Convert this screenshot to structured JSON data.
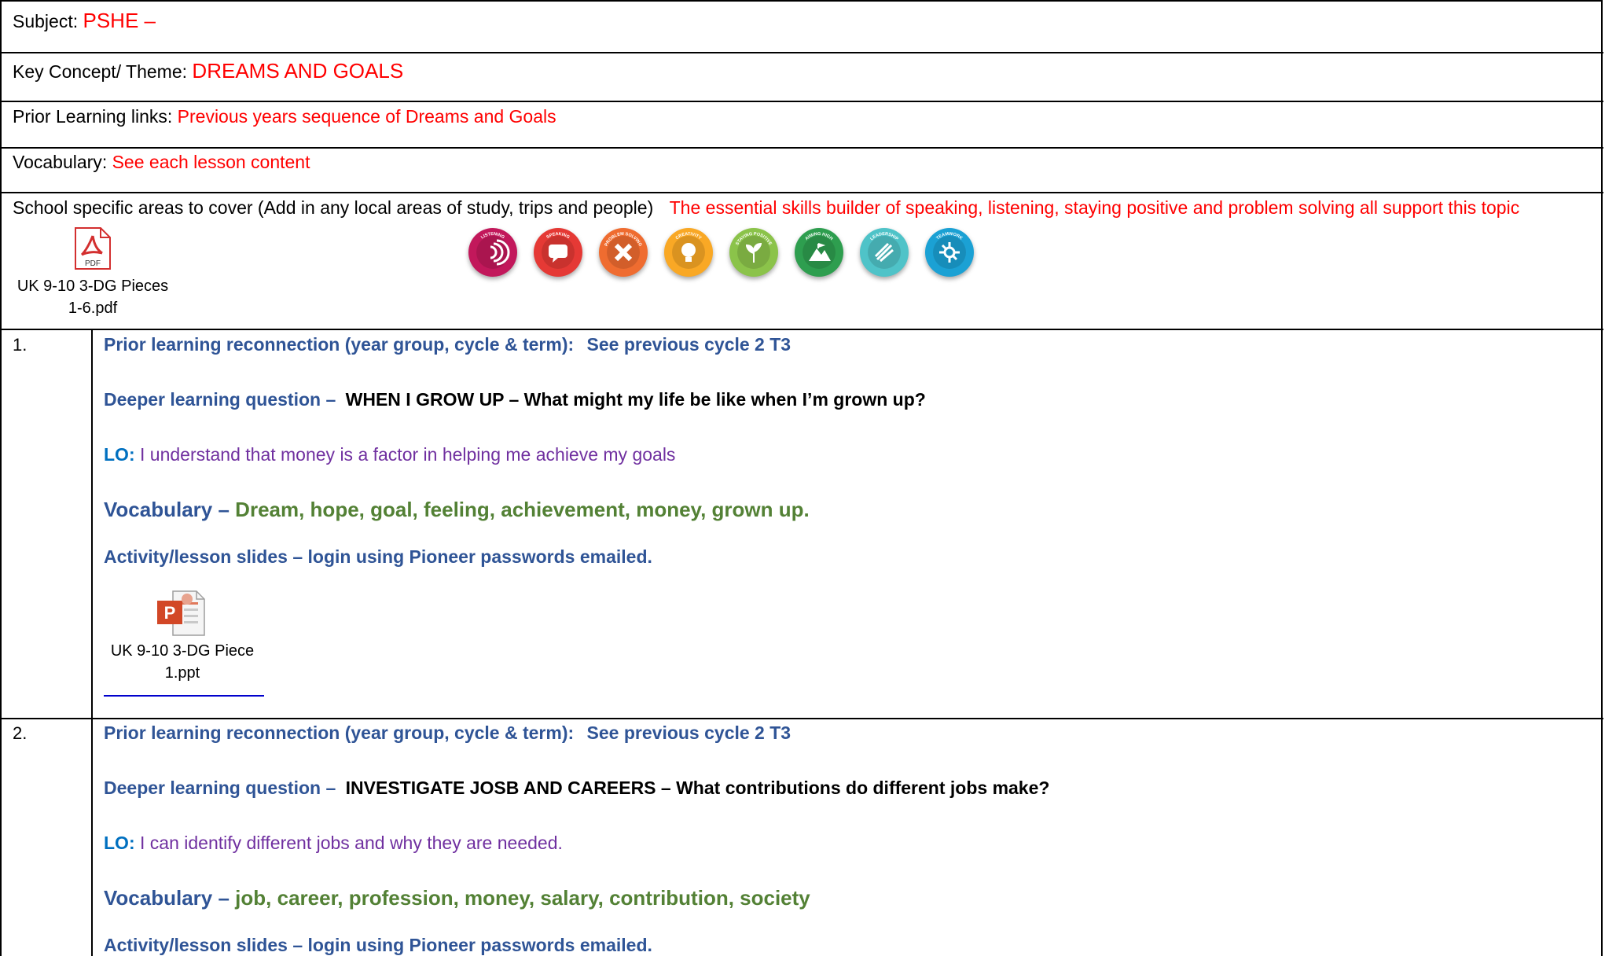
{
  "header": {
    "subject_label": "Subject:",
    "subject_value": "PSHE –",
    "theme_label": "Key Concept/ Theme",
    "theme_value": "DREAMS AND GOALS",
    "prior_label": "Prior Learning links:",
    "prior_value": "Previous years sequence of  Dreams and Goals",
    "vocab_label": "Vocabulary",
    "vocab_value": "See each lesson content",
    "school_label": "School specific areas to cover (Add in any local areas of study, trips and people)",
    "school_value": "The essential skills builder of speaking, listening, staying positive and problem solving all support this topic",
    "pdf_name_line1": "UK 9-10 3-DG Pieces",
    "pdf_name_line2": "1-6.pdf",
    "pdf_icon_text": "PDF"
  },
  "badges": [
    {
      "name": "LISTENING",
      "color": "#c2185b"
    },
    {
      "name": "SPEAKING",
      "color": "#e53935"
    },
    {
      "name": "PROBLEM SOLVING",
      "color": "#ef6c30"
    },
    {
      "name": "CREATIVITY",
      "color": "#f9a825"
    },
    {
      "name": "STAYING POSITIVE",
      "color": "#8bc34a"
    },
    {
      "name": "AIMING HIGH",
      "color": "#2e9e4f"
    },
    {
      "name": "LEADERSHIP",
      "color": "#4fc3c8"
    },
    {
      "name": "TEAMWORK",
      "color": "#1ba1d4"
    }
  ],
  "lessons": [
    {
      "number": "1.",
      "prior_label": "Prior learning reconnection (year group, cycle & term):",
      "prior_value": "See previous cycle 2 T3",
      "question_label": "Deeper learning question –",
      "question_value": "WHEN I GROW UP – What might my life be like when I’m grown up?",
      "lo_label": "LO:",
      "lo_value": "I understand that money is a factor in helping me achieve my goals",
      "vocab_label": "Vocabulary –",
      "vocab_value": "Dream, hope, goal, feeling, achievement, money, grown up.",
      "activity": "Activity/lesson slides – login using Pioneer passwords emailed.",
      "attachment_line1": "UK 9-10 3-DG Piece",
      "attachment_line2": "1.ppt"
    },
    {
      "number": "2.",
      "prior_label": "Prior learning reconnection (year group, cycle & term):",
      "prior_value": "See previous cycle 2 T3",
      "question_label": "Deeper learning question –",
      "question_value": "INVESTIGATE JOSB AND CAREERS – What contributions do different jobs make?",
      "lo_label": "LO:",
      "lo_value": "I can identify different jobs and why they are needed.",
      "vocab_label": "Vocabulary –",
      "vocab_value": "job, career, profession, money, salary, contribution, society",
      "activity": "Activity/lesson slides – login using Pioneer passwords emailed."
    }
  ]
}
